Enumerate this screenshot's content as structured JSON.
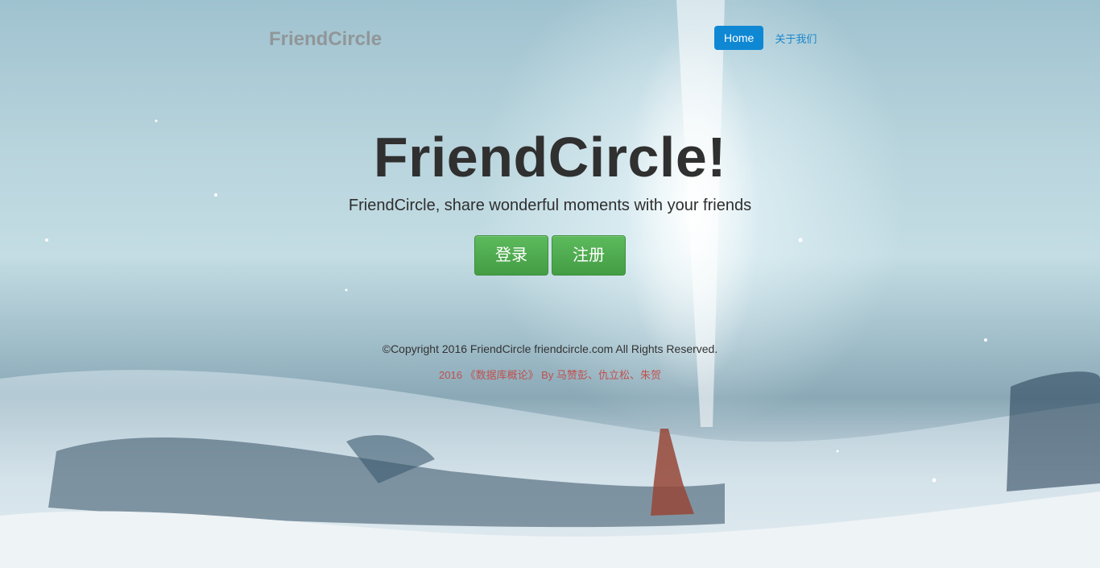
{
  "header": {
    "brand": "FriendCircle",
    "nav": {
      "home_label": "Home",
      "about_label": "关于我们"
    }
  },
  "hero": {
    "title": "FriendCircle!",
    "subtitle": "FriendCircle, share wonderful moments with your friends",
    "login_label": "登录",
    "register_label": "注册"
  },
  "footer": {
    "copyright": "©Copyright 2016 FriendCircle friendcircle.com All Rights Reserved.",
    "credits": "2016 《数据库概论》 By 马赞彭、仇立松、朱贺"
  },
  "colors": {
    "primary": "#0f88d4",
    "success": "#449d44",
    "credit_text": "#c0504d"
  }
}
